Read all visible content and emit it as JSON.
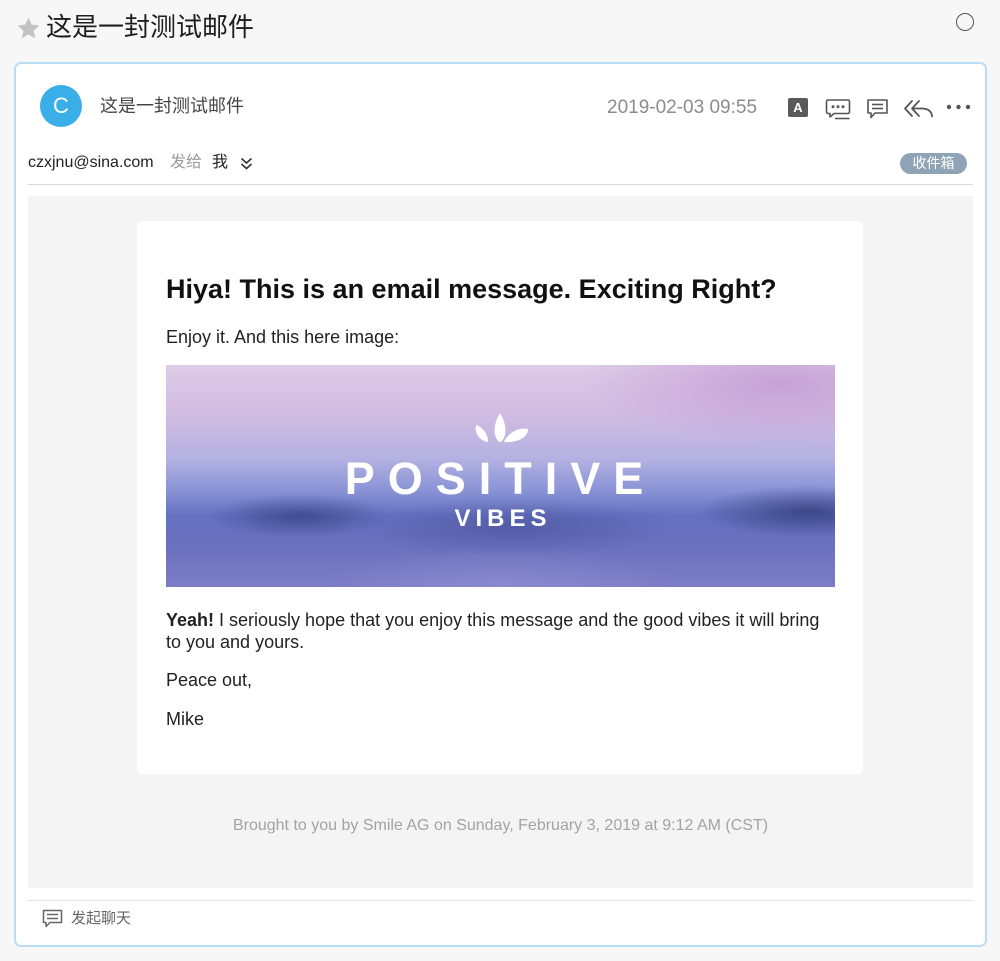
{
  "window": {
    "title": "这是一封测试邮件"
  },
  "header_icons": {
    "favorite": "star-icon",
    "status": "circle-icon"
  },
  "message": {
    "avatar_letter": "C",
    "subject": "这是一封测试邮件",
    "date": "2019-02-03 09:55",
    "from": "czxjnu@sina.com",
    "sent_to_label": "发给",
    "recipient": "我",
    "folder_badge": "收件箱"
  },
  "toolbar": {
    "translate_glyph": "A",
    "icons": [
      "translate-icon",
      "quick-reply-icon",
      "comment-icon",
      "reply-all-icon",
      "more-icon"
    ]
  },
  "body": {
    "heading": "Hiya! This is an email message. Exciting Right?",
    "intro": "Enjoy it. And this here image:",
    "banner": {
      "title": "POSITIVE",
      "subtitle": "VIBES",
      "logo_icon": "splash-logo-icon"
    },
    "paragraph_bold": "Yeah!",
    "paragraph_rest": " I seriously hope that you enjoy this message and the good vibes it will bring to you and yours.",
    "signoff": "Peace out,",
    "signature": "Mike"
  },
  "footer": {
    "text": "Brought to you by Smile AG on Sunday, February 3, 2019 at 9:12 AM (CST)"
  },
  "bottom_bar": {
    "chat_label": "发起聊天",
    "chat_icon": "chat-bubble-icon"
  },
  "colors": {
    "avatar": "#3aaee8",
    "card_border": "#b9ddf4",
    "badge": "#8fa3b6",
    "star": "#c3c3c3",
    "content_background": "#f4f4f4"
  }
}
